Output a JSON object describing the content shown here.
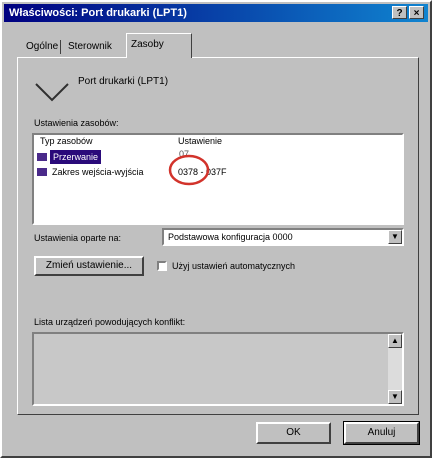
{
  "window": {
    "title": "Właściwości: Port drukarki (LPT1)",
    "help_button": "?",
    "close_button": "×"
  },
  "tabs": [
    {
      "label": "Ogólne"
    },
    {
      "label": "Sterownik"
    },
    {
      "label": "Zasoby"
    }
  ],
  "device": {
    "name": "Port drukarki (LPT1)"
  },
  "resources": {
    "group_label": "Ustawienia zasobów:",
    "col_type": "Typ zasobów",
    "col_setting": "Ustawienie",
    "rows": [
      {
        "type": "Przerwanie",
        "setting": "07"
      },
      {
        "type": "Zakres wejścia-wyjścia",
        "setting": "0378 - 037F"
      }
    ]
  },
  "settings_based": {
    "label": "Ustawienia oparte na:",
    "value": "Podstawowa konfiguracja 0000"
  },
  "change_button": "Zmień ustawienie...",
  "auto_checkbox": {
    "label": "Użyj ustawień automatycznych",
    "checked": false
  },
  "conflict": {
    "label": "Lista urządzeń powodujących konflikt:"
  },
  "buttons": {
    "ok": "OK",
    "cancel": "Anuluj"
  },
  "colors": {
    "title_start": "#000080",
    "title_end": "#1084d0",
    "highlight_circle": "#d2332b",
    "selection": "#2a0a7a"
  }
}
